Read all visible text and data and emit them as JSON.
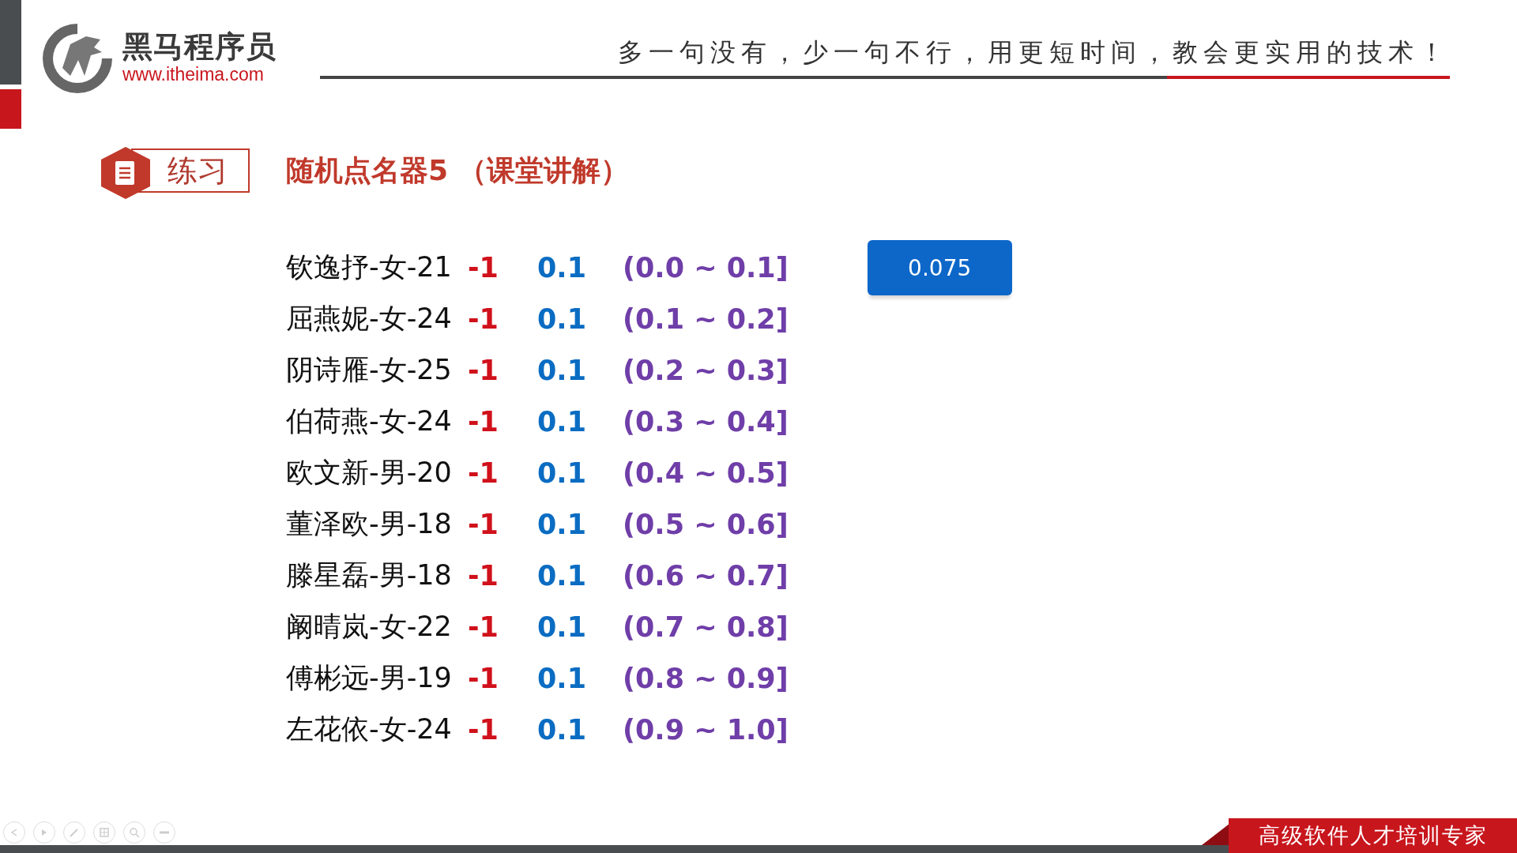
{
  "header": {
    "logo_name": "黑马程序员",
    "logo_url": "www.itheima.com",
    "tagline": "多一句没有，少一句不行，用更短时间，教会更实用的技术！"
  },
  "section": {
    "badge": "练习",
    "title": "随机点名器5 （课堂讲解）"
  },
  "rows": [
    {
      "name": "钦逸抒-女-21",
      "weight": "-1",
      "probability": "0.1",
      "range": "(0.0 ~ 0.1]"
    },
    {
      "name": "屈燕妮-女-24",
      "weight": "-1",
      "probability": "0.1",
      "range": "(0.1 ~ 0.2]"
    },
    {
      "name": "阴诗雁-女-25",
      "weight": "-1",
      "probability": "0.1",
      "range": "(0.2 ~ 0.3]"
    },
    {
      "name": "伯荷燕-女-24",
      "weight": "-1",
      "probability": "0.1",
      "range": "(0.3 ~ 0.4]"
    },
    {
      "name": "欧文新-男-20",
      "weight": "-1",
      "probability": "0.1",
      "range": "(0.4 ~ 0.5]"
    },
    {
      "name": "董泽欧-男-18",
      "weight": "-1",
      "probability": "0.1",
      "range": "(0.5 ~ 0.6]"
    },
    {
      "name": "滕星磊-男-18",
      "weight": "-1",
      "probability": "0.1",
      "range": "(0.6 ~ 0.7]"
    },
    {
      "name": "阚晴岚-女-22",
      "weight": "-1",
      "probability": "0.1",
      "range": "(0.7 ~ 0.8]"
    },
    {
      "name": "傅彬远-男-19",
      "weight": "-1",
      "probability": "0.1",
      "range": "(0.8 ~ 0.9]"
    },
    {
      "name": "左花依-女-24",
      "weight": "-1",
      "probability": "0.1",
      "range": "(0.9 ~ 1.0]"
    }
  ],
  "result_button": "0.075",
  "footer": {
    "banner": "高级软件人才培训专家"
  },
  "slideshow_controls": [
    {
      "kind": "previous"
    },
    {
      "kind": "next"
    },
    {
      "kind": "pen"
    },
    {
      "kind": "slides"
    },
    {
      "kind": "zoom"
    },
    {
      "kind": "more"
    }
  ]
}
